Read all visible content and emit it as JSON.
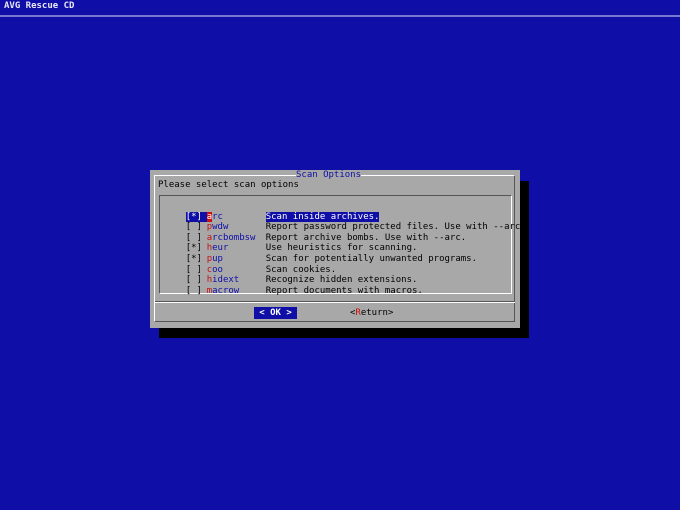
{
  "backtitle": "AVG Rescue CD",
  "dialog": {
    "title": "Scan Options",
    "prompt": "Please select scan options"
  },
  "items": [
    {
      "checked": true,
      "mark": "[*]",
      "hotkey": "a",
      "tag_rest": "rc",
      "description": "Scan inside archives.",
      "selected": true
    },
    {
      "checked": false,
      "mark": "[ ]",
      "hotkey": "p",
      "tag_rest": "wdw",
      "description": "Report password protected files. Use with --arc.",
      "selected": false
    },
    {
      "checked": false,
      "mark": "[ ]",
      "hotkey": "a",
      "tag_rest": "rcbombsw",
      "description": "Report archive bombs. Use with --arc.",
      "selected": false
    },
    {
      "checked": true,
      "mark": "[*]",
      "hotkey": "h",
      "tag_rest": "eur",
      "description": "Use heuristics for scanning.",
      "selected": false
    },
    {
      "checked": true,
      "mark": "[*]",
      "hotkey": "p",
      "tag_rest": "up",
      "description": "Scan for potentially unwanted programs.",
      "selected": false
    },
    {
      "checked": false,
      "mark": "[ ]",
      "hotkey": "c",
      "tag_rest": "oo",
      "description": "Scan cookies.",
      "selected": false
    },
    {
      "checked": false,
      "mark": "[ ]",
      "hotkey": "h",
      "tag_rest": "idext",
      "description": "Recognize hidden extensions.",
      "selected": false
    },
    {
      "checked": false,
      "mark": "[ ]",
      "hotkey": "m",
      "tag_rest": "acrow",
      "description": "Report documents with macros.",
      "selected": false
    }
  ],
  "buttons": {
    "ok": {
      "open": "<",
      "label": " OK ",
      "close": ">",
      "focused": true
    },
    "return": {
      "open": "<",
      "hotkey": "R",
      "rest": "eturn",
      "close": ">",
      "focused": false
    }
  },
  "colors": {
    "background": "#0f0fa8",
    "dialog": "#a8a8a8",
    "shadow": "#000000",
    "hotkey": "#c81010",
    "tag": "#0f0fa8",
    "highlight": "#0f0fa8"
  }
}
